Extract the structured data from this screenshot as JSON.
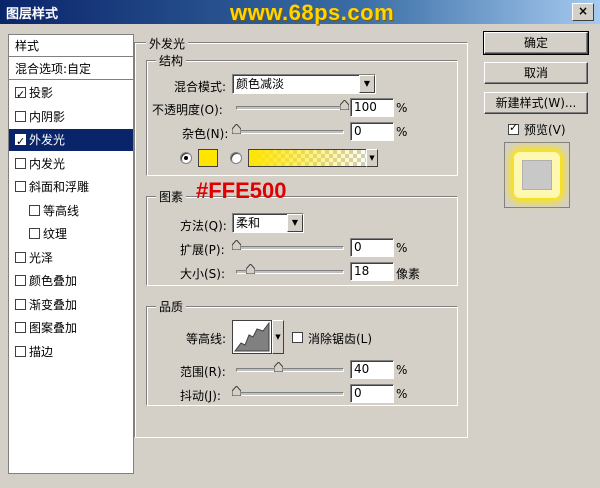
{
  "window": {
    "title": "图层样式",
    "watermark": "www.68ps.com",
    "close": "×"
  },
  "sidebar": {
    "header": "样式",
    "blend_options": "混合选项:自定",
    "items": [
      {
        "label": "投影",
        "checked": true
      },
      {
        "label": "内阴影",
        "checked": false
      },
      {
        "label": "外发光",
        "checked": true,
        "selected": true
      },
      {
        "label": "内发光",
        "checked": false
      },
      {
        "label": "斜面和浮雕",
        "checked": false
      },
      {
        "label": "等高线",
        "checked": false,
        "indent": true
      },
      {
        "label": "纹理",
        "checked": false,
        "indent": true
      },
      {
        "label": "光泽",
        "checked": false
      },
      {
        "label": "颜色叠加",
        "checked": false
      },
      {
        "label": "渐变叠加",
        "checked": false
      },
      {
        "label": "图案叠加",
        "checked": false
      },
      {
        "label": "描边",
        "checked": false
      }
    ]
  },
  "panel": {
    "title": "外发光",
    "structure": {
      "title": "结构",
      "blend_mode_label": "混合模式:",
      "blend_mode_value": "颜色减淡",
      "opacity_label": "不透明度(O):",
      "opacity_value": "100",
      "opacity_fraction": 1.0,
      "noise_label": "杂色(N):",
      "noise_value": "0",
      "noise_fraction": 0.0,
      "percent": "%"
    },
    "elements": {
      "title": "图素",
      "technique_label": "方法(Q):",
      "technique_value": "柔和",
      "spread_label": "扩展(P):",
      "spread_value": "0",
      "size_label": "大小(S):",
      "size_value": "18",
      "size_unit": "像素",
      "percent": "%"
    },
    "quality": {
      "title": "品质",
      "contour_label": "等高线:",
      "anti_alias_label": "消除锯齿(L)",
      "range_label": "范围(R):",
      "range_value": "40",
      "jitter_label": "抖动(J):",
      "jitter_value": "0",
      "percent": "%"
    }
  },
  "annotation": "#FFE500",
  "colors": {
    "glow": "#ffe500",
    "selection": "#0a246a"
  },
  "buttons": {
    "ok": "确定",
    "cancel": "取消",
    "new_style": "新建样式(W)...",
    "preview": "预览(V)"
  }
}
